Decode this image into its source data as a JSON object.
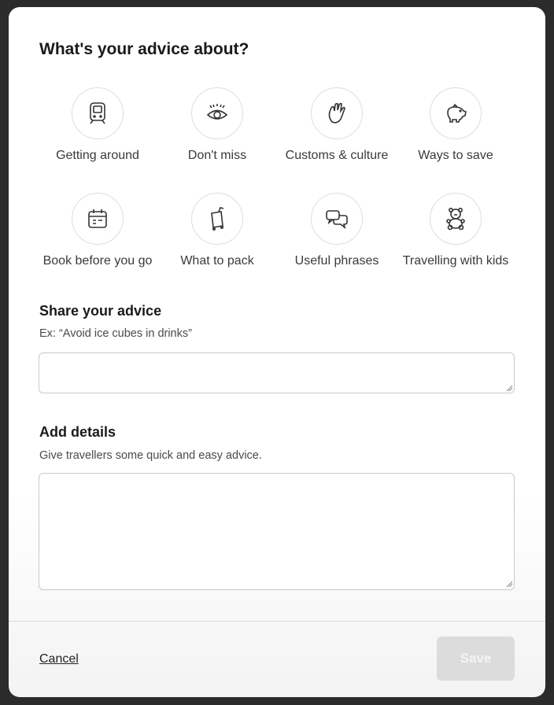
{
  "dialog": {
    "title": "What's your advice about?",
    "categories": [
      {
        "label": "Getting around",
        "icon": "train-icon"
      },
      {
        "label": "Don't miss",
        "icon": "eye-icon"
      },
      {
        "label": "Customs & culture",
        "icon": "waving-hand-icon"
      },
      {
        "label": "Ways to save",
        "icon": "piggy-bank-icon"
      },
      {
        "label": "Book before you go",
        "icon": "calendar-icon"
      },
      {
        "label": "What to pack",
        "icon": "luggage-icon"
      },
      {
        "label": "Useful phrases",
        "icon": "speech-bubbles-icon"
      },
      {
        "label": "Travelling with kids",
        "icon": "teddy-bear-icon"
      }
    ],
    "share_section": {
      "title": "Share your advice",
      "subtitle": "Ex: “Avoid ice cubes in drinks”",
      "value": ""
    },
    "details_section": {
      "title": "Add details",
      "subtitle": "Give travellers some quick and easy advice.",
      "value": ""
    },
    "footer": {
      "cancel_label": "Cancel",
      "save_label": "Save"
    }
  }
}
